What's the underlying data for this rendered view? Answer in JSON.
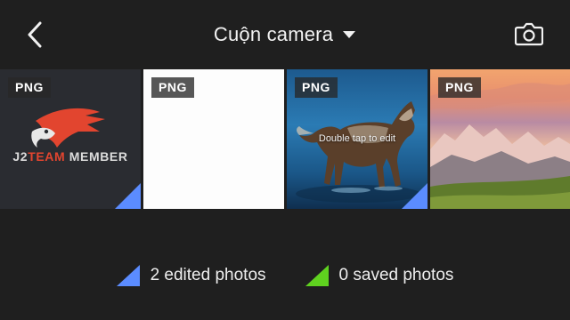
{
  "header": {
    "title": "Cuộn camera",
    "back_icon": "chevron-left-icon",
    "dropdown_icon": "caret-down-icon",
    "camera_icon": "camera-icon"
  },
  "tiles": [
    {
      "badge": "PNG",
      "brand_prefix": "J2",
      "brand_accent": "TEAM",
      "brand_suffix": " MEMBER",
      "edited": true
    },
    {
      "badge": "PNG",
      "edited": false
    },
    {
      "badge": "PNG",
      "hint": "Double tap to edit",
      "edited": true
    },
    {
      "badge": "PNG",
      "edited": false
    }
  ],
  "legend": {
    "edited_label": "2 edited photos",
    "saved_label": "0 saved photos",
    "edited_color": "#5b8cff",
    "saved_color": "#5fd21f"
  }
}
